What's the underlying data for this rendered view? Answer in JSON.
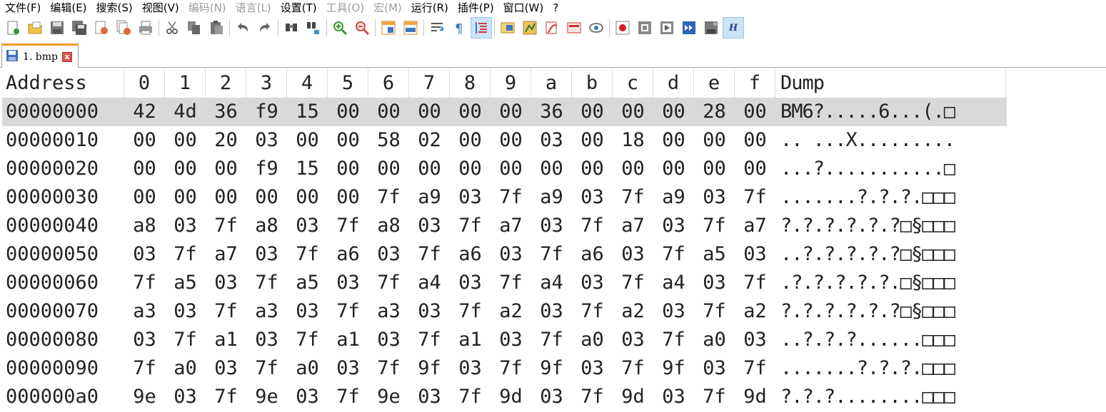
{
  "menu": {
    "items": [
      {
        "label": "文件(F)",
        "enabled": true
      },
      {
        "label": "编辑(E)",
        "enabled": true
      },
      {
        "label": "搜索(S)",
        "enabled": true
      },
      {
        "label": "视图(V)",
        "enabled": true
      },
      {
        "label": "编码(N)",
        "enabled": false
      },
      {
        "label": "语言(L)",
        "enabled": false
      },
      {
        "label": "设置(T)",
        "enabled": true
      },
      {
        "label": "工具(O)",
        "enabled": false
      },
      {
        "label": "宏(M)",
        "enabled": false
      },
      {
        "label": "运行(R)",
        "enabled": true
      },
      {
        "label": "插件(P)",
        "enabled": true
      },
      {
        "label": "窗口(W)",
        "enabled": true
      },
      {
        "label": "?",
        "enabled": true
      }
    ]
  },
  "toolbar": {
    "icons": [
      "new-file-icon",
      "open-file-icon",
      "save-icon",
      "save-all-icon",
      "close-icon",
      "close-all-icon",
      "print-icon",
      "cut-icon",
      "copy-icon",
      "paste-icon",
      "undo-icon",
      "redo-icon",
      "find-icon",
      "replace-icon",
      "zoom-in-icon",
      "zoom-out-icon",
      "sync-vertical-icon",
      "sync-horizontal-icon",
      "word-wrap-icon",
      "show-all-chars-icon",
      "indent-guide-icon",
      "doc-map-icon",
      "function-list-icon",
      "folder-workspace-icon",
      "doc-list-icon",
      "monitor-icon",
      "record-macro-icon",
      "stop-macro-icon",
      "play-macro-icon",
      "play-multiple-icon",
      "save-macro-icon",
      "hex-editor-icon"
    ],
    "hex_label": "H"
  },
  "tab": {
    "label": "1. bmp",
    "close_glyph": "x"
  },
  "hex_view": {
    "header": {
      "address": "Address",
      "columns": [
        "0",
        "1",
        "2",
        "3",
        "4",
        "5",
        "6",
        "7",
        "8",
        "9",
        "a",
        "b",
        "c",
        "d",
        "e",
        "f"
      ],
      "dump": "Dump"
    },
    "selected_row": 0,
    "rows": [
      {
        "address": "00000000",
        "bytes": [
          "42",
          "4d",
          "36",
          "f9",
          "15",
          "00",
          "00",
          "00",
          "00",
          "00",
          "36",
          "00",
          "00",
          "00",
          "28",
          "00"
        ],
        "dump": "BM6?.....6...(.□"
      },
      {
        "address": "00000010",
        "bytes": [
          "00",
          "00",
          "20",
          "03",
          "00",
          "00",
          "58",
          "02",
          "00",
          "00",
          "03",
          "00",
          "18",
          "00",
          "00",
          "00"
        ],
        "dump": ".. ...X........."
      },
      {
        "address": "00000020",
        "bytes": [
          "00",
          "00",
          "00",
          "f9",
          "15",
          "00",
          "00",
          "00",
          "00",
          "00",
          "00",
          "00",
          "00",
          "00",
          "00",
          "00"
        ],
        "dump": "...?...........□"
      },
      {
        "address": "00000030",
        "bytes": [
          "00",
          "00",
          "00",
          "00",
          "00",
          "00",
          "7f",
          "a9",
          "03",
          "7f",
          "a9",
          "03",
          "7f",
          "a9",
          "03",
          "7f"
        ],
        "dump": ".......?.?.?.□□□"
      },
      {
        "address": "00000040",
        "bytes": [
          "a8",
          "03",
          "7f",
          "a8",
          "03",
          "7f",
          "a8",
          "03",
          "7f",
          "a7",
          "03",
          "7f",
          "a7",
          "03",
          "7f",
          "a7"
        ],
        "dump": "?.?.?.?.?.?□§□□□"
      },
      {
        "address": "00000050",
        "bytes": [
          "03",
          "7f",
          "a7",
          "03",
          "7f",
          "a6",
          "03",
          "7f",
          "a6",
          "03",
          "7f",
          "a6",
          "03",
          "7f",
          "a5",
          "03"
        ],
        "dump": "..?.?.?.?.?□§□□□"
      },
      {
        "address": "00000060",
        "bytes": [
          "7f",
          "a5",
          "03",
          "7f",
          "a5",
          "03",
          "7f",
          "a4",
          "03",
          "7f",
          "a4",
          "03",
          "7f",
          "a4",
          "03",
          "7f"
        ],
        "dump": ".?.?.?.?.?.□§□□□"
      },
      {
        "address": "00000070",
        "bytes": [
          "a3",
          "03",
          "7f",
          "a3",
          "03",
          "7f",
          "a3",
          "03",
          "7f",
          "a2",
          "03",
          "7f",
          "a2",
          "03",
          "7f",
          "a2"
        ],
        "dump": "?.?.?.?.?.?□§□□□"
      },
      {
        "address": "00000080",
        "bytes": [
          "03",
          "7f",
          "a1",
          "03",
          "7f",
          "a1",
          "03",
          "7f",
          "a1",
          "03",
          "7f",
          "a0",
          "03",
          "7f",
          "a0",
          "03"
        ],
        "dump": "..?.?.?......□□□"
      },
      {
        "address": "00000090",
        "bytes": [
          "7f",
          "a0",
          "03",
          "7f",
          "a0",
          "03",
          "7f",
          "9f",
          "03",
          "7f",
          "9f",
          "03",
          "7f",
          "9f",
          "03",
          "7f"
        ],
        "dump": ".......?.?.?.□□□"
      },
      {
        "address": "000000a0",
        "bytes": [
          "9e",
          "03",
          "7f",
          "9e",
          "03",
          "7f",
          "9e",
          "03",
          "7f",
          "9d",
          "03",
          "7f",
          "9d",
          "03",
          "7f",
          "9d"
        ],
        "dump": "?.?.?........□□□"
      }
    ]
  }
}
